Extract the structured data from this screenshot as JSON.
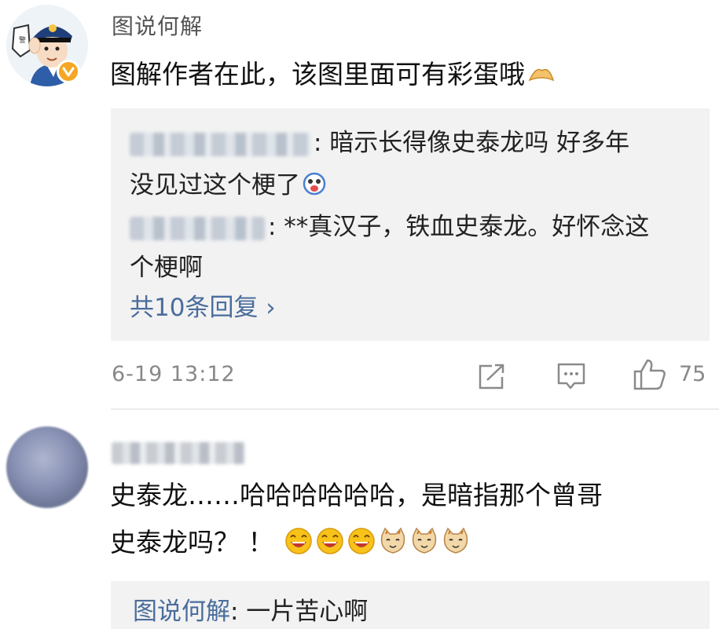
{
  "comment1": {
    "author": "图说何解",
    "text": "图解作者在此，该图里面可有彩蛋哦",
    "text_emoji": "pray-hands-emoji",
    "replies": [
      {
        "author_blurred": true,
        "line1": ": 暗示长得像史泰龙吗  好多年",
        "line2": "没见过这个梗了",
        "emoji": "shocked-face-emoji"
      },
      {
        "author_blurred": true,
        "line1": ": **真汉子，铁血史泰龙。好怀念这",
        "line2": "个梗啊"
      }
    ],
    "more_replies": "共10条回复  ›",
    "time": "6-19 13:12",
    "likes": "75",
    "icons": [
      "share-icon",
      "comment-icon",
      "like-icon"
    ]
  },
  "comment2": {
    "author_blurred": true,
    "line1": "史泰龙……哈哈哈哈哈哈，是暗指那个曾哥",
    "line2": "史泰龙吗？ ！",
    "emojis": [
      "laugh-emoji",
      "laugh-emoji",
      "laugh-emoji",
      "cat-emoji",
      "cat-emoji",
      "cat-emoji"
    ],
    "reply_author": "图说何解",
    "reply_text": ": 一片苦心啊"
  },
  "colors": {
    "link": "#4a6d9c",
    "reply_bg": "#f2f2f2",
    "verified": "#f5a623"
  }
}
